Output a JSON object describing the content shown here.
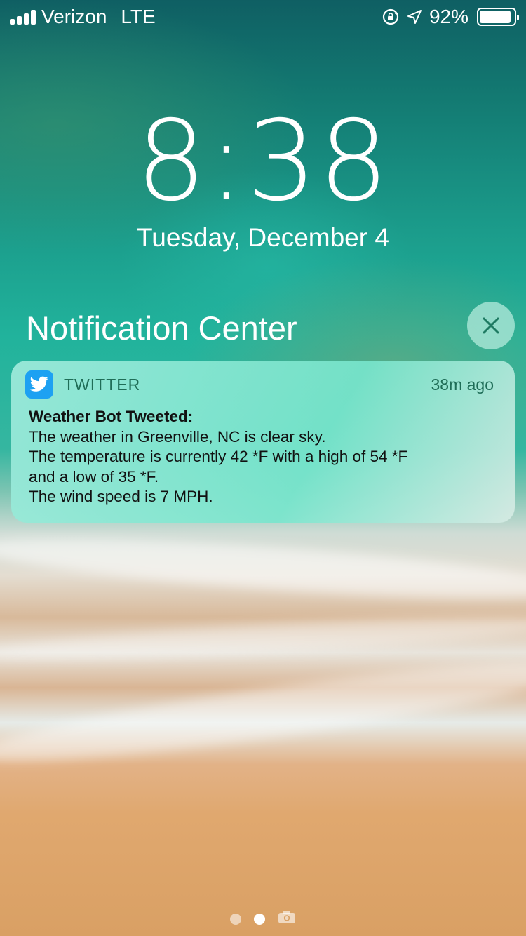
{
  "status_bar": {
    "carrier": "Verizon",
    "network": "LTE",
    "battery_percent": "92%",
    "battery_level": 0.92,
    "icons": [
      "signal-icon",
      "rotation-lock-icon",
      "location-icon",
      "battery-icon"
    ]
  },
  "lock_screen": {
    "time": "8:38",
    "date": "Tuesday, December 4"
  },
  "notification_center": {
    "title": "Notification Center",
    "clear_icon": "close-icon"
  },
  "notification": {
    "app_name": "TWITTER",
    "app_icon": "twitter-bird-icon",
    "app_color": "#1da1f2",
    "time_ago": "38m ago",
    "title": "Weather Bot Tweeted:",
    "lines": [
      "The weather in Greenville, NC is clear sky.",
      "The temperature is currently 42 *F with a high of 54 *F",
      "and a low of 35 *F.",
      "The wind speed is 7 MPH."
    ]
  },
  "page_indicator": {
    "pages": 2,
    "active_index": 1,
    "extra_icon": "camera-icon"
  }
}
